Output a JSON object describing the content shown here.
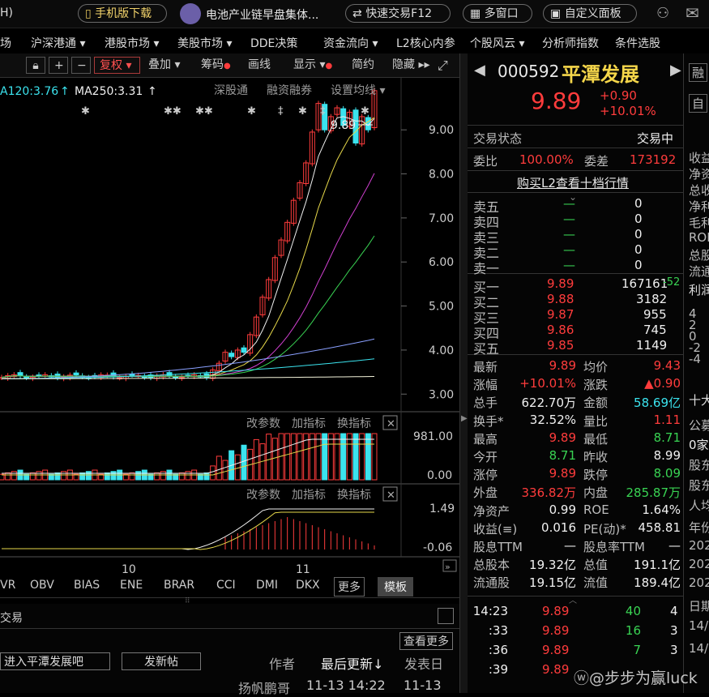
{
  "topbar": {
    "left_fragment": "H)",
    "mobile_download": "手机版下载",
    "news": "电池产业链早盘集体...",
    "quick_trade": "快速交易F12",
    "multi_window": "多窗口",
    "custom_panel": "自定义面板"
  },
  "nav": {
    "items": [
      "场",
      "沪深港通",
      "港股市场",
      "美股市场",
      "DDE决策",
      "资金流向",
      "L2核心内参",
      "个股风云",
      "分析师指数",
      "条件选股"
    ]
  },
  "chart_toolbar": {
    "fuquan": "复权",
    "diejia": "叠加",
    "chouma": "筹码",
    "huaxian": "画线",
    "xianshi": "显示",
    "jianyue": "简约",
    "yincang": "隐藏"
  },
  "ma_legend": {
    "ma120": "A120:3.76",
    "ma250": "MA250:3.31"
  },
  "chart_links": {
    "shentong": "深股通",
    "rongzi": "融资融券",
    "junxian": "设置均线"
  },
  "price_axis": [
    "9.00",
    "8.00",
    "7.00",
    "6.00",
    "5.00",
    "4.00",
    "3.00"
  ],
  "high_marker": "9.89",
  "vol_panel": {
    "gaicanshu": "改参数",
    "jiazhibiao": "加指标",
    "huanzhibiao": "换指标",
    "axis_top": "981.00",
    "axis_bottom": "0.00"
  },
  "macd_panel": {
    "gaicanshu": "改参数",
    "jiazhibiao": "加指标",
    "huanzhibiao": "换指标",
    "axis_top": "1.49",
    "axis_bottom": "-0.06"
  },
  "month_labels": [
    "10",
    "11"
  ],
  "indicator_tabs": [
    "VR",
    "OBV",
    "BIAS",
    "ENE",
    "BRAR",
    "CCI",
    "DMI",
    "DKX",
    "更多",
    "模板"
  ],
  "bottom": {
    "jiaoyi": "交易",
    "enter_forum": "进入平潭发展吧",
    "new_post": "发新帖",
    "see_more": "查看更多",
    "author": "作者",
    "last_update": "最后更新↓",
    "post_date": "发表日",
    "row_author": "扬帆鹏哥",
    "row_update": "11-13 14:22",
    "row_date": "11-13"
  },
  "stock": {
    "code": "000592",
    "name": "平潭发展",
    "price": "9.89",
    "change": "+0.90",
    "change_pct": "+10.01%"
  },
  "trade_status": {
    "label": "交易状态",
    "value": "交易中"
  },
  "weibi": {
    "label": "委比",
    "value": "100.00%",
    "label2": "委差",
    "value2": "173192"
  },
  "l2_link": "购买L2查看十档行情",
  "sells": [
    {
      "label": "卖五",
      "price": "—",
      "vol": "0"
    },
    {
      "label": "卖四",
      "price": "—",
      "vol": "0"
    },
    {
      "label": "卖三",
      "price": "—",
      "vol": "0"
    },
    {
      "label": "卖二",
      "price": "—",
      "vol": "0"
    },
    {
      "label": "卖一",
      "price": "—",
      "vol": "0"
    }
  ],
  "buys": [
    {
      "label": "买一",
      "price": "9.89",
      "vol": "167161",
      "extra": "-52"
    },
    {
      "label": "买二",
      "price": "9.88",
      "vol": "3182",
      "extra": ""
    },
    {
      "label": "买三",
      "price": "9.87",
      "vol": "955",
      "extra": ""
    },
    {
      "label": "买四",
      "price": "9.86",
      "vol": "745",
      "extra": ""
    },
    {
      "label": "买五",
      "price": "9.85",
      "vol": "1149",
      "extra": ""
    }
  ],
  "stats": [
    {
      "l1": "最新",
      "v1": "9.89",
      "c1": "red",
      "l2": "均价",
      "v2": "9.43",
      "c2": "red"
    },
    {
      "l1": "涨幅",
      "v1": "+10.01%",
      "c1": "red",
      "l2": "涨跌",
      "v2": "▲0.90",
      "c2": "red"
    },
    {
      "l1": "总手",
      "v1": "622.70万",
      "c1": "wht",
      "l2": "金额",
      "v2": "58.69亿",
      "c2": "cyn"
    },
    {
      "l1": "换手*",
      "v1": "32.52%",
      "c1": "wht",
      "l2": "量比",
      "v2": "1.11",
      "c2": "red"
    },
    {
      "l1": "最高",
      "v1": "9.89",
      "c1": "red",
      "l2": "最低",
      "v2": "8.71",
      "c2": "grn"
    },
    {
      "l1": "今开",
      "v1": "8.71",
      "c1": "grn",
      "l2": "昨收",
      "v2": "8.99",
      "c2": "wht"
    },
    {
      "l1": "涨停",
      "v1": "9.89",
      "c1": "red",
      "l2": "跌停",
      "v2": "8.09",
      "c2": "grn"
    },
    {
      "l1": "外盘",
      "v1": "336.82万",
      "c1": "red",
      "l2": "内盘",
      "v2": "285.87万",
      "c2": "grn"
    },
    {
      "l1": "净资产",
      "v1": "0.99",
      "c1": "wht",
      "l2": "ROE",
      "v2": "1.64%",
      "c2": "wht"
    },
    {
      "l1": "收益(≡)",
      "v1": "0.016",
      "c1": "wht",
      "l2": "PE(动)*",
      "v2": "458.81",
      "c2": "wht"
    },
    {
      "l1": "股息TTM",
      "v1": "—",
      "c1": "wht",
      "l2": "股息率TTM",
      "v2": "—",
      "c2": "wht"
    },
    {
      "l1": "总股本",
      "v1": "19.32亿",
      "c1": "wht",
      "l2": "总值",
      "v2": "191.1亿",
      "c2": "wht"
    },
    {
      "l1": "流通股",
      "v1": "19.15亿",
      "c1": "wht",
      "l2": "流值",
      "v2": "189.4亿",
      "c2": "wht"
    }
  ],
  "ticks": [
    {
      "time": "14:23",
      "price": "9.89",
      "vol": "40",
      "n": "4"
    },
    {
      "time": ":33",
      "price": "9.89",
      "vol": "16",
      "n": "3"
    },
    {
      "time": ":36",
      "price": "9.89",
      "vol": "7",
      "n": "3"
    },
    {
      "time": ":39",
      "price": "9.89",
      "vol": "",
      "n": ""
    }
  ],
  "far_right": {
    "top_items": [
      "融",
      "自"
    ],
    "fin_items": [
      "收益",
      "净资",
      "总收",
      "净利",
      "毛利",
      "ROE",
      "总股",
      "流通"
    ],
    "lirun": "利润",
    "lirun_axis": [
      "4",
      "2",
      "0",
      "-2",
      "-4"
    ],
    "shida": "十大",
    "gonggao": "公募",
    "jia": "0家",
    "gudong": [
      "股东",
      "股东",
      "人均"
    ],
    "nianfen": "年份",
    "years": [
      "202",
      "202",
      "202"
    ],
    "riqi": "日期",
    "dates": [
      "14/",
      "14/"
    ]
  },
  "watermark": "@步步为赢luck",
  "chart_data": {
    "type": "candlestick",
    "ylim": [
      2.6,
      10.2
    ],
    "y_ticks": [
      9.0,
      8.0,
      7.0,
      6.0,
      5.0,
      4.0,
      3.0
    ],
    "x_month_labels": [
      "10",
      "11"
    ],
    "last_close": 9.89
  }
}
